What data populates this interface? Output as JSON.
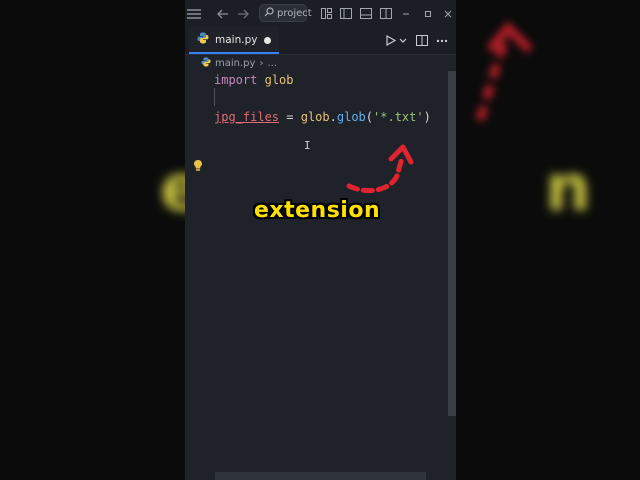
{
  "editor_window": {
    "search_placeholder": "project",
    "tab": {
      "label": "main.py",
      "dirty": true
    },
    "breadcrumb": {
      "file": "main.py",
      "ellipsis": "..."
    },
    "code": {
      "line1": {
        "keyword": "import",
        "module": "glob"
      },
      "line3": {
        "variable": "jpg_files",
        "operator": "=",
        "object": "glob",
        "dot": ".",
        "function": "glob",
        "open": "(",
        "string": "'*.txt'",
        "close": ")"
      }
    }
  },
  "caption": {
    "text": "extension",
    "color": "#ffe000"
  },
  "colors": {
    "arrow": "#e0242f",
    "accent_tab": "#3b82f6"
  },
  "icons": [
    "menu-icon",
    "back-icon",
    "forward-icon",
    "search-icon",
    "layout-icon",
    "sidebar-icon",
    "panel-icon",
    "split-icon",
    "minimize-icon",
    "maximize-icon",
    "close-icon",
    "python-icon",
    "run-icon",
    "split-editor-icon",
    "more-icon",
    "lightbulb-icon"
  ]
}
